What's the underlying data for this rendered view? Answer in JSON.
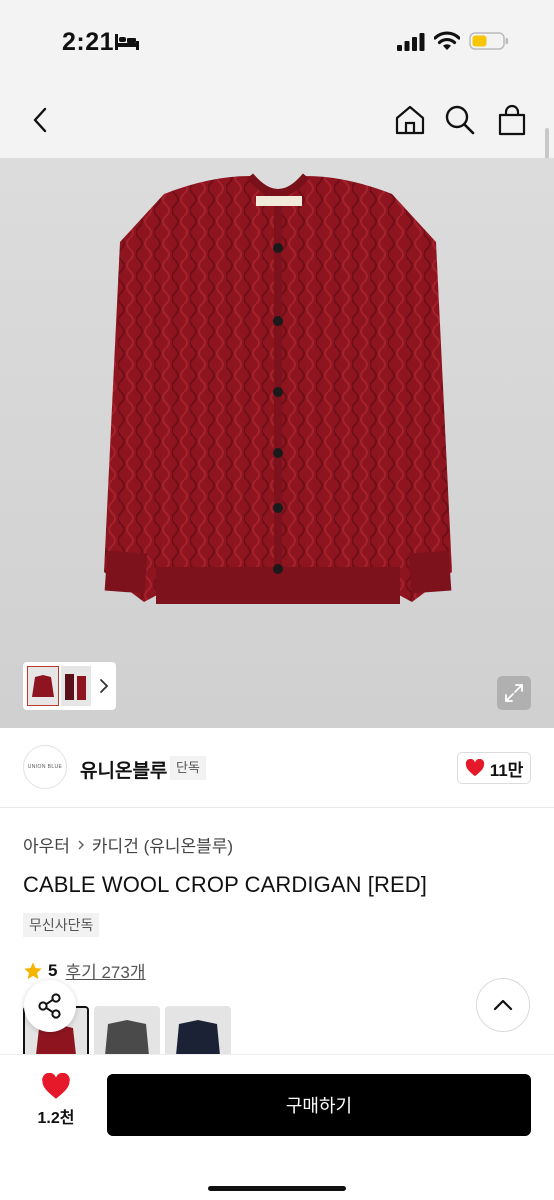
{
  "status_bar": {
    "time": "2:21"
  },
  "icons": {
    "back": "chevron-left-icon",
    "home": "home-icon",
    "search": "search-icon",
    "cart": "shopping-bag-icon",
    "expand": "expand-icon",
    "share": "share-icon",
    "scroll_top": "chevron-up-icon",
    "heart": "heart-icon",
    "star": "star-icon"
  },
  "colors": {
    "accent": "#e5192a",
    "star": "#f4b400",
    "product": "#8e1520",
    "buy_button": "#000000"
  },
  "brand": {
    "logo_text": "UNION BLUE",
    "name": "유니온블루",
    "badge": "단독",
    "likes": "11만"
  },
  "product": {
    "breadcrumb": [
      "아우터",
      "카디건 (유니온블루)"
    ],
    "title": "CABLE WOOL CROP CARDIGAN [RED]",
    "tag": "무신사단독",
    "rating": "5",
    "review_link": "후기 273개"
  },
  "bottom_bar": {
    "wish_count": "1.2천",
    "buy_label": "구매하기"
  }
}
